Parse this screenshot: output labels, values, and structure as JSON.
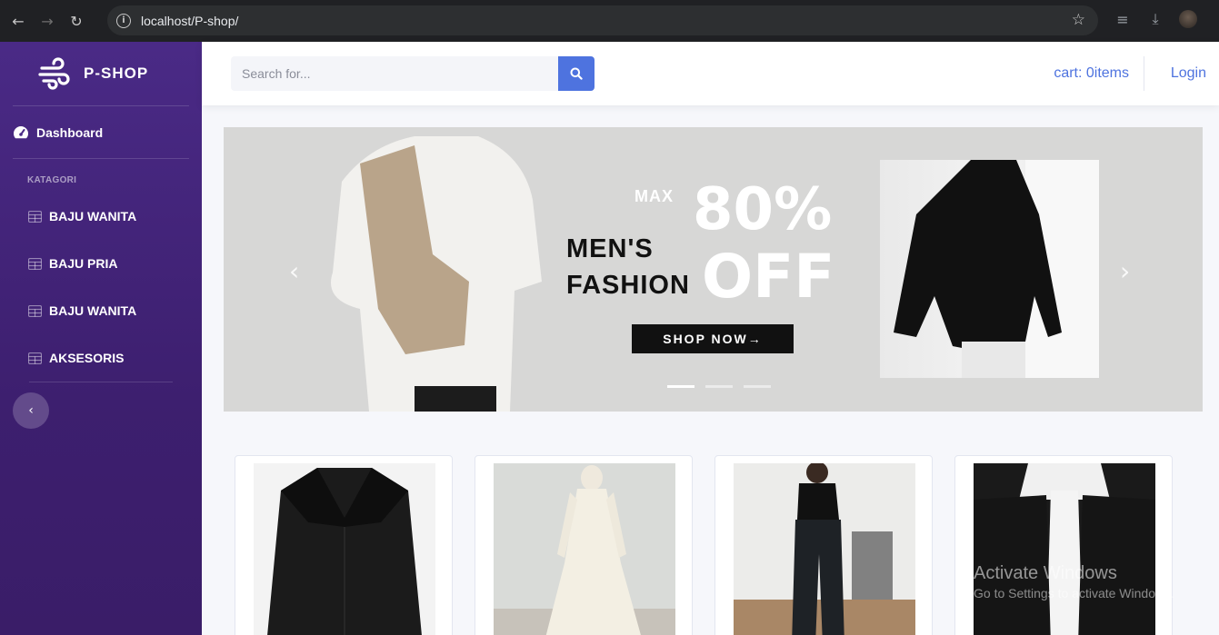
{
  "browser": {
    "url": "localhost/P-shop/",
    "icons": [
      "back-arrow-icon",
      "forward-arrow-icon",
      "reload-icon",
      "info-icon",
      "bookmark-star-icon",
      "media-queue-icon",
      "download-icon",
      "profile-avatar"
    ]
  },
  "sidebar": {
    "brand": "P-SHOP",
    "dashboard_label": "Dashboard",
    "section_heading": "KATAGORI",
    "categories": [
      {
        "label": "BAJU WANITA"
      },
      {
        "label": "BAJU PRIA"
      },
      {
        "label": "BAJU WANITA"
      },
      {
        "label": "AKSESORIS"
      }
    ],
    "toggle_icon": "chevron-left-icon"
  },
  "topbar": {
    "search_placeholder": "Search for...",
    "cart_label": "cart: 0items",
    "login_label": "Login"
  },
  "carousel": {
    "max_text": "MAX",
    "percent_text": "80%",
    "off_text": "OFF",
    "headline": "MEN'S FASHION",
    "cta": "SHOP NOW→",
    "active_slide": 1,
    "slide_count": 3
  },
  "products": [
    {
      "image": "black blouse with ruffle collar"
    },
    {
      "image": "cream long dress"
    },
    {
      "image": "black crop top with wide pants"
    },
    {
      "image": "black jacket with white hoodie"
    }
  ],
  "watermark": {
    "line1": "Activate Windows",
    "line2": "Go to Settings to activate Windows."
  },
  "colors": {
    "sidebar": "#4a2a86",
    "accent": "#4e73df",
    "chrome": "#202124"
  }
}
